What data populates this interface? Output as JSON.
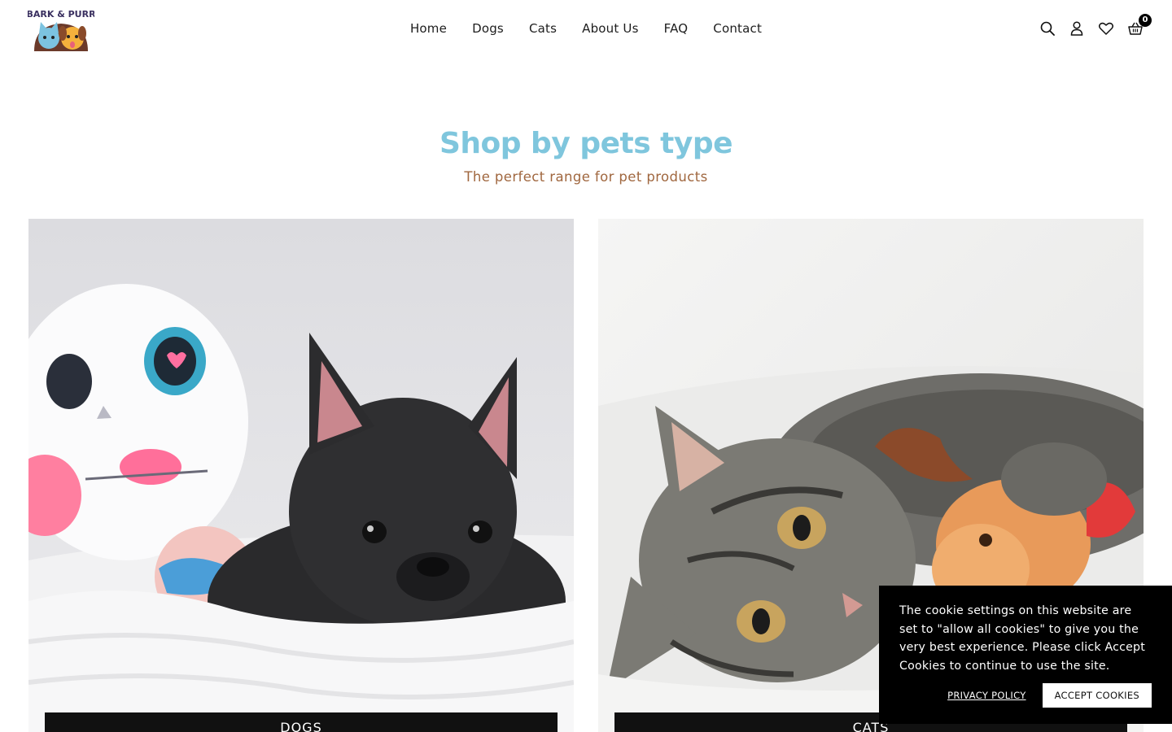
{
  "header": {
    "logo_text": "BARK & PURR",
    "nav": [
      "Home",
      "Dogs",
      "Cats",
      "About Us",
      "FAQ",
      "Contact"
    ],
    "icons": [
      "search-icon",
      "account-icon",
      "heart-icon",
      "basket-icon"
    ],
    "cart_count": "0"
  },
  "section": {
    "title": "Shop by pets type",
    "subtitle": "The perfect range for pet products"
  },
  "cards": [
    {
      "label": "DOGS"
    },
    {
      "label": "CATS"
    }
  ],
  "cookie": {
    "text": "The cookie settings on this website are set to \"allow all cookies\" to give you the very best experience. Please click Accept Cookies to continue to use the site.",
    "privacy_label": "PRIVACY POLICY",
    "accept_label": "ACCEPT COOKIES"
  },
  "colors": {
    "title": "#7fc6dd",
    "subtitle": "#a0673f",
    "banner": "#000000"
  }
}
